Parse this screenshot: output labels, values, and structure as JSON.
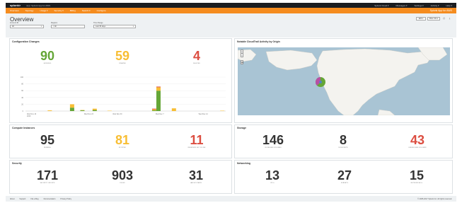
{
  "topbar": {
    "logo": "splunk>",
    "app_name": "App: Splunk App for AWS",
    "right_items": [
      "Splunk Cloud ▾",
      "Messages ▾",
      "Settings ▾",
      "Activity ▾",
      "Help ▾"
    ]
  },
  "appbar": {
    "nav": [
      "Overview",
      "Topology",
      "Usage ▾",
      "Security ▾",
      "Billing",
      "Search ▾",
      "Configure"
    ],
    "app_title": "Splunk App for AWS"
  },
  "header": {
    "title": "Overview",
    "buttons": [
      "Edit ▾",
      "More Info ▾"
    ],
    "icons": [
      "print-icon",
      "export-icon"
    ]
  },
  "filters": [
    {
      "label": "Account ID",
      "value": "All"
    },
    {
      "label": "Regions",
      "value": "× All"
    },
    {
      "label": "Time Range",
      "value": "Last 30 days"
    }
  ],
  "config_changes": {
    "title": "Configuration Changes",
    "metrics": [
      {
        "value": "90",
        "label": "MODIFIED",
        "color": "#65a637"
      },
      {
        "value": "59",
        "label": "CREATED",
        "color": "#f8be34"
      },
      {
        "value": "4",
        "label": "DELETED",
        "color": "#dc4e41"
      }
    ]
  },
  "chart_data": {
    "type": "bar",
    "stacked": true,
    "categories": [
      "Wed Nov 16 2016",
      "Wed Nov 23",
      "Wed Nov 30",
      "Wed Dec 7",
      "Wed Dec 14"
    ],
    "x_tick_labels": [
      "Wed Nov 16\n2016",
      "Wed Nov 23",
      "Wed Nov 30",
      "Wed Dec 7",
      "Wed Dec 14"
    ],
    "y_ticks": [
      "0",
      "20",
      "40",
      "60",
      "80",
      "100"
    ],
    "ylim": [
      0,
      100
    ],
    "bars": [
      {
        "slot": 0.85,
        "values": [
          0,
          2,
          0
        ]
      },
      {
        "slot": 1.63,
        "values": [
          10,
          10,
          0
        ]
      },
      {
        "slot": 1.99,
        "values": [
          2,
          1,
          0
        ]
      },
      {
        "slot": 2.42,
        "values": [
          3,
          4,
          0
        ]
      },
      {
        "slot": 2.94,
        "values": [
          0,
          1,
          0
        ]
      },
      {
        "slot": 4.5,
        "values": [
          2,
          3,
          2
        ]
      },
      {
        "slot": 4.65,
        "values": [
          60,
          10,
          2
        ]
      },
      {
        "slot": 5.19,
        "values": [
          0,
          8,
          0
        ]
      },
      {
        "slot": 6.88,
        "values": [
          0,
          1,
          0
        ]
      }
    ],
    "series": [
      {
        "color": "#65a637"
      },
      {
        "color": "#f8be34"
      },
      {
        "color": "#dc4e41"
      }
    ]
  },
  "map_panel": {
    "title": "Notable CloudTrail Activity by Origin",
    "zoom_in": "+",
    "zoom_out": "−"
  },
  "compute": {
    "title": "Compute Instances",
    "metrics": [
      {
        "value": "95",
        "label": "RUNNING",
        "color": "#333333"
      },
      {
        "value": "81",
        "label": "STOPPED",
        "color": "#f8be34"
      },
      {
        "value": "11",
        "label": "RESERVED NOT IN USE",
        "color": "#dc4e41"
      }
    ]
  },
  "storage": {
    "title": "Storage",
    "metrics": [
      {
        "value": "146",
        "label": "IN USE EBS VOLUMES",
        "color": "#333333"
      },
      {
        "value": "8",
        "label": "S3 BUCKETS",
        "color": "#333333"
      },
      {
        "value": "43",
        "label": "UNUSED EBS VOLUMES",
        "color": "#dc4e41"
      }
    ]
  },
  "security": {
    "title": "Security",
    "metrics": [
      {
        "value": "171",
        "label": "SECURITY GROUPS",
        "color": "#333333"
      },
      {
        "value": "903",
        "label": "RULES",
        "color": "#333333"
      },
      {
        "value": "31",
        "label": "IAM KEY PAIRS",
        "color": "#333333"
      }
    ]
  },
  "networking": {
    "title": "Networking",
    "metrics": [
      {
        "value": "13",
        "label": "VPCs",
        "color": "#333333"
      },
      {
        "value": "27",
        "label": "SUBNETS",
        "color": "#333333"
      },
      {
        "value": "15",
        "label": "NETWORK ACLs",
        "color": "#333333"
      }
    ]
  },
  "footer": {
    "links": [
      "About",
      "Support",
      "File a Bug",
      "Documentation",
      "Privacy Policy"
    ],
    "copyright": "© 2005-2017 Splunk Inc. All rights reserved."
  }
}
